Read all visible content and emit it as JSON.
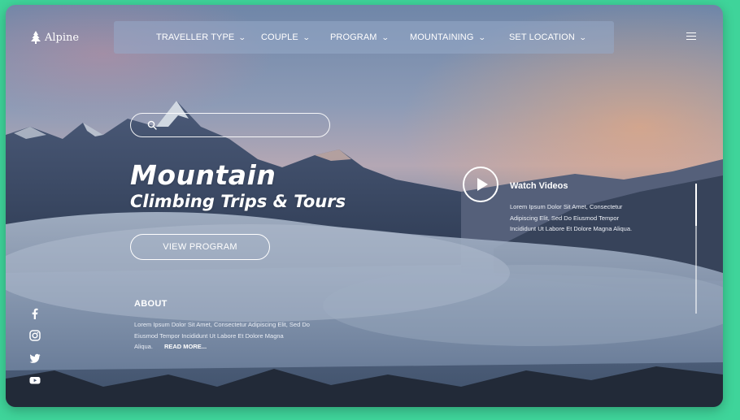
{
  "brand": {
    "name": "Alpine",
    "logo_icon": "tree-icon"
  },
  "nav": {
    "items": [
      {
        "label": "TRAVELLER TYPE",
        "icon": "chevron-down-icon"
      },
      {
        "label": "COUPLE",
        "icon": "chevron-down-icon"
      },
      {
        "label": "PROGRAM",
        "icon": "chevron-down-icon"
      },
      {
        "label": "MOUNTAINING",
        "icon": "chevron-down-icon"
      },
      {
        "label": "SET LOCATION",
        "icon": "chevron-down-icon"
      }
    ],
    "menu_icon": "hamburger-menu-icon"
  },
  "search": {
    "placeholder": "",
    "value": "",
    "icon": "search-icon"
  },
  "hero": {
    "title": "Mountain",
    "subtitle": "Climbing Trips & Tours",
    "cta_label": "VIEW PROGRAM"
  },
  "about": {
    "title": "ABOUT",
    "text": "Lorem Ipsum Dolor Sit Amet, Consectetur Adipiscing Elit, Sed Do Eiusmod Tempor Incididunt Ut Labore Et Dolore Magna Aliqua.",
    "read_more": "READ MORE..."
  },
  "video": {
    "title": "Watch Videos",
    "text": "Lorem Ipsum Dolor Sit Amet, Consectetur Adipiscing Elit, Sed Do Eiusmod Tempor Incididunt Ut Labore Et Dolore Magna Aliqua.",
    "icon": "play-icon"
  },
  "social": [
    "facebook-icon",
    "instagram-icon",
    "twitter-icon",
    "youtube-icon"
  ],
  "colors": {
    "page_bg": "#3fd49a",
    "text": "#ffffff",
    "nav_bg": "#96aac8"
  }
}
